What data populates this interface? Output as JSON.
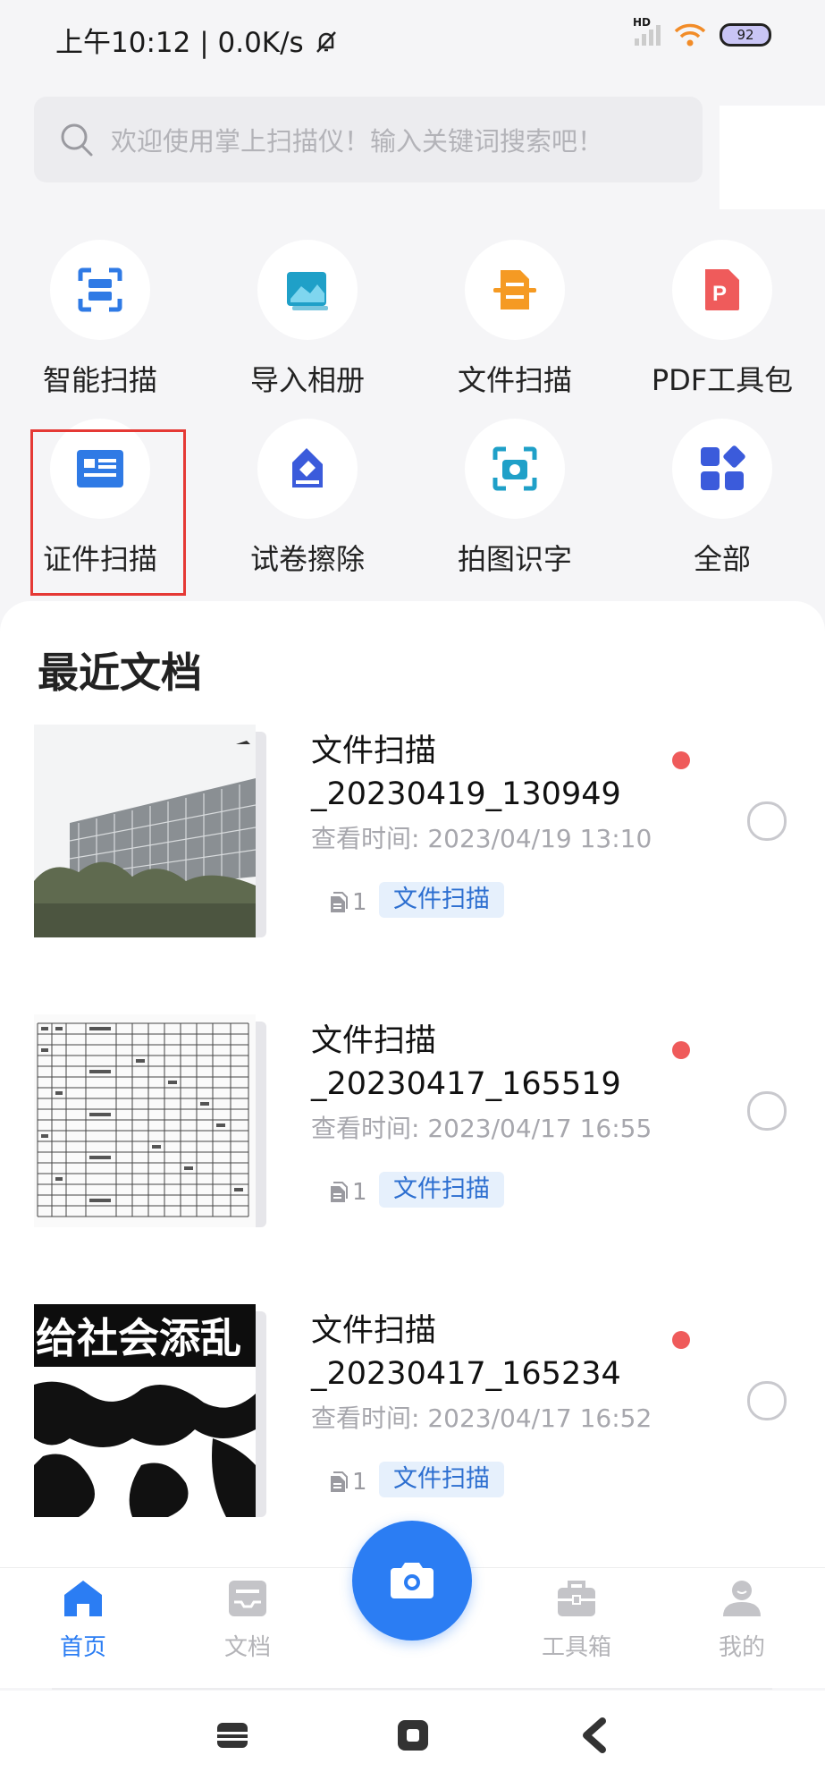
{
  "status_bar": {
    "time": "上午10:12 | 0.0K/s",
    "network": "HD",
    "battery": "92"
  },
  "search": {
    "placeholder": "欢迎使用掌上扫描仪！输入关键词搜索吧！"
  },
  "shortcuts": [
    {
      "label": "智能扫描",
      "icon": "smart-scan-icon",
      "color": "#2f7ae5"
    },
    {
      "label": "导入相册",
      "icon": "import-album-icon",
      "color": "#1fa0c8"
    },
    {
      "label": "文件扫描",
      "icon": "file-scan-icon",
      "color": "#f59a23"
    },
    {
      "label": "PDF工具包",
      "icon": "pdf-icon",
      "color": "#ef5b5b"
    },
    {
      "label": "证件扫描",
      "icon": "id-card-icon",
      "color": "#2f7ae5"
    },
    {
      "label": "试卷擦除",
      "icon": "eraser-icon",
      "color": "#3b5bdb"
    },
    {
      "label": "拍图识字",
      "icon": "camera-ocr-icon",
      "color": "#1fa0c8"
    },
    {
      "label": "全部",
      "icon": "all-apps-icon",
      "color": "#3b5bdb"
    }
  ],
  "recent": {
    "title": "最近文档",
    "docs": [
      {
        "title": "文件扫描\n_20230419_130949",
        "time": "查看时间: 2023/04/19 13:10",
        "count": "1",
        "tag": "文件扫描"
      },
      {
        "title": "文件扫描\n_20230417_165519",
        "time": "查看时间: 2023/04/17 16:55",
        "count": "1",
        "tag": "文件扫描"
      },
      {
        "title": "文件扫描\n_20230417_165234",
        "time": "查看时间: 2023/04/17 16:52",
        "count": "1",
        "tag": "文件扫描"
      }
    ]
  },
  "thumb_text": "给社会添乱",
  "tabs": [
    {
      "label": "首页",
      "icon": "home-icon"
    },
    {
      "label": "文档",
      "icon": "documents-icon"
    },
    {
      "label": "工具箱",
      "icon": "toolbox-icon"
    },
    {
      "label": "我的",
      "icon": "profile-icon"
    }
  ],
  "colors": {
    "accent": "#2b7df3",
    "highlight": "#e53935",
    "tag_bg": "#e6f0fc",
    "dot": "#ef5b5b"
  }
}
